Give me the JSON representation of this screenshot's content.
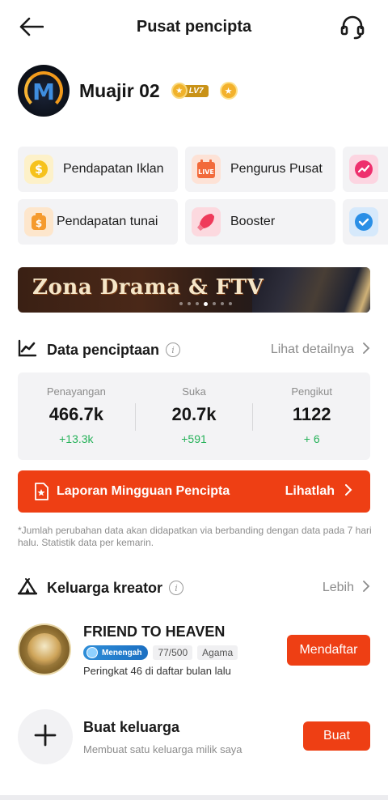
{
  "header": {
    "title": "Pusat pencipta"
  },
  "profile": {
    "name": "Muajir 02",
    "level_badge": "LV7",
    "avatar_letter": "M"
  },
  "tools": [
    {
      "label": "Pendapatan Iklan",
      "icon": "dollar-coin-icon",
      "color": "#f6c21c"
    },
    {
      "label": "Pengurus Pusat",
      "icon": "live-calendar-icon",
      "color": "#f26a3a"
    },
    {
      "label": "",
      "icon": "trending-bolt-icon",
      "color": "#ee2f6d"
    },
    {
      "label": "Pendapatan tunai",
      "icon": "cash-bag-icon",
      "color": "#f59a2d"
    },
    {
      "label": "Booster",
      "icon": "rocket-icon",
      "color": "#ef3a5a"
    },
    {
      "label": "",
      "icon": "check-badge-icon",
      "color": "#2a8fe6"
    }
  ],
  "banner": {
    "title": "Zona Drama & FTV"
  },
  "creation_data": {
    "title": "Data penciptaan",
    "more_label": "Lihat detailnya",
    "stats": [
      {
        "label": "Penayangan",
        "value": "466.7k",
        "delta": "+13.3k"
      },
      {
        "label": "Suka",
        "value": "20.7k",
        "delta": "+591"
      },
      {
        "label": "Pengikut",
        "value": "1122",
        "delta": "+ 6"
      }
    ]
  },
  "weekly_report": {
    "label": "Laporan Mingguan Pencipta",
    "action": "Lihatlah"
  },
  "note": "*Jumlah perubahan data akan didapatkan via berbanding dengan data pada 7 hari halu. Statistik data per kemarin.",
  "creator_family": {
    "title": "Keluarga kreator",
    "more_label": "Lebih",
    "family": {
      "name": "FRIEND TO HEAVEN",
      "level": "Menengah",
      "members": "77/500",
      "category": "Agama",
      "rank_text": "Peringkat 46 di daftar bulan lalu",
      "join_label": "Mendaftar"
    },
    "create": {
      "title": "Buat keluarga",
      "subtitle": "Membuat satu keluarga milik saya",
      "button_label": "Buat"
    }
  },
  "colors": {
    "accent": "#ee3f14",
    "positive": "#27b25a",
    "muted": "#8c8c8c",
    "card_bg": "#f3f3f5"
  }
}
